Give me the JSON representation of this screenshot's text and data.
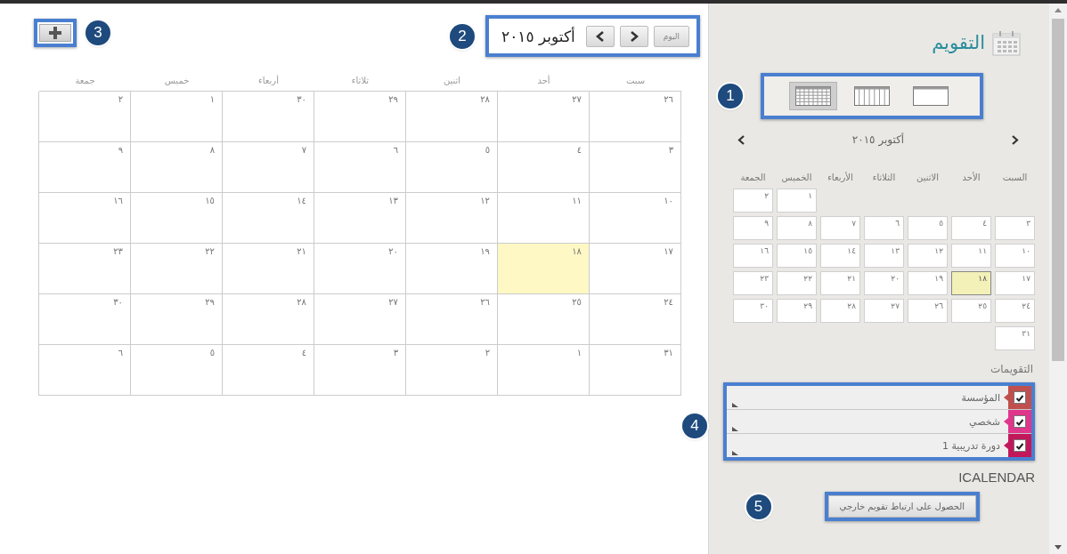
{
  "main": {
    "nav": {
      "callout": "2",
      "today_button": "اليوم",
      "month_title": "أكتوبر ٢٠١٥"
    },
    "add": {
      "callout": "3"
    },
    "weekdays": [
      "سبت",
      "أحد",
      "اثنين",
      "ثلاثاء",
      "أربعاء",
      "خميس",
      "جمعة"
    ],
    "weeks": [
      [
        {
          "day": "٢٦",
          "today": false
        },
        {
          "day": "٢٧",
          "today": false
        },
        {
          "day": "٢٨",
          "today": false
        },
        {
          "day": "٢٩",
          "today": false
        },
        {
          "day": "٣٠",
          "today": false
        },
        {
          "day": "١",
          "today": false
        },
        {
          "day": "٢",
          "today": false
        }
      ],
      [
        {
          "day": "٣",
          "today": false
        },
        {
          "day": "٤",
          "today": false
        },
        {
          "day": "٥",
          "today": false
        },
        {
          "day": "٦",
          "today": false
        },
        {
          "day": "٧",
          "today": false
        },
        {
          "day": "٨",
          "today": false
        },
        {
          "day": "٩",
          "today": false
        }
      ],
      [
        {
          "day": "١٠",
          "today": false
        },
        {
          "day": "١١",
          "today": false
        },
        {
          "day": "١٢",
          "today": false
        },
        {
          "day": "١٣",
          "today": false
        },
        {
          "day": "١٤",
          "today": false
        },
        {
          "day": "١٥",
          "today": false
        },
        {
          "day": "١٦",
          "today": false
        }
      ],
      [
        {
          "day": "١٧",
          "today": false
        },
        {
          "day": "١٨",
          "today": true
        },
        {
          "day": "١٩",
          "today": false
        },
        {
          "day": "٢٠",
          "today": false
        },
        {
          "day": "٢١",
          "today": false
        },
        {
          "day": "٢٢",
          "today": false
        },
        {
          "day": "٢٣",
          "today": false
        }
      ],
      [
        {
          "day": "٢٤",
          "today": false
        },
        {
          "day": "٢٥",
          "today": false
        },
        {
          "day": "٢٦",
          "today": false
        },
        {
          "day": "٢٧",
          "today": false
        },
        {
          "day": "٢٨",
          "today": false
        },
        {
          "day": "٢٩",
          "today": false
        },
        {
          "day": "٣٠",
          "today": false
        }
      ],
      [
        {
          "day": "٣١",
          "today": false
        },
        {
          "day": "١",
          "today": false
        },
        {
          "day": "٢",
          "today": false
        },
        {
          "day": "٣",
          "today": false
        },
        {
          "day": "٤",
          "today": false
        },
        {
          "day": "٥",
          "today": false
        },
        {
          "day": "٦",
          "today": false
        }
      ]
    ]
  },
  "sidebar": {
    "title": "التقويم",
    "views_callout": "1",
    "views": [
      {
        "kind": "day",
        "selected": false
      },
      {
        "kind": "week",
        "selected": false
      },
      {
        "kind": "month",
        "selected": true
      }
    ],
    "mini_calendar": {
      "month_title": "أكتوبر ٢٠١٥",
      "weekdays": [
        "السبت",
        "الأحد",
        "الاثنين",
        "الثلاثاء",
        "الأربعاء",
        "الخميس",
        "الجمعة"
      ],
      "weeks": [
        [
          {
            "day": "١",
            "today": false
          },
          {
            "day": "٢",
            "today": false
          }
        ],
        [
          {
            "day": "٣",
            "today": false
          },
          {
            "day": "٤",
            "today": false
          },
          {
            "day": "٥",
            "today": false
          },
          {
            "day": "٦",
            "today": false
          },
          {
            "day": "٧",
            "today": false
          },
          {
            "day": "٨",
            "today": false
          },
          {
            "day": "٩",
            "today": false
          }
        ],
        [
          {
            "day": "١٠",
            "today": false
          },
          {
            "day": "١١",
            "today": false
          },
          {
            "day": "١٢",
            "today": false
          },
          {
            "day": "١٣",
            "today": false
          },
          {
            "day": "١٤",
            "today": false
          },
          {
            "day": "١٥",
            "today": false
          },
          {
            "day": "١٦",
            "today": false
          }
        ],
        [
          {
            "day": "١٧",
            "today": false
          },
          {
            "day": "١٨",
            "today": true
          },
          {
            "day": "١٩",
            "today": false
          },
          {
            "day": "٢٠",
            "today": false
          },
          {
            "day": "٢١",
            "today": false
          },
          {
            "day": "٢٢",
            "today": false
          },
          {
            "day": "٢٣",
            "today": false
          }
        ],
        [
          {
            "day": "٢٤",
            "today": false
          },
          {
            "day": "٢٥",
            "today": false
          },
          {
            "day": "٢٦",
            "today": false
          },
          {
            "day": "٢٧",
            "today": false
          },
          {
            "day": "٢٨",
            "today": false
          },
          {
            "day": "٢٩",
            "today": false
          },
          {
            "day": "٣٠",
            "today": false
          }
        ],
        [
          {
            "day": "٣١",
            "today": false
          }
        ]
      ]
    },
    "calendars_title": "التقويمات",
    "calendars_callout": "4",
    "calendars": [
      {
        "name": "المؤسسة",
        "checked": true,
        "color": "#c0504d"
      },
      {
        "name": "شخصي",
        "checked": true,
        "color": "#e0368c"
      },
      {
        "name": "دورة تدريبية 1",
        "checked": true,
        "color": "#c2185b"
      }
    ],
    "icalendar_title": "ICALENDAR",
    "export_callout": "5",
    "export_button": "الحصول على ارتباط تقويم خارجي"
  }
}
